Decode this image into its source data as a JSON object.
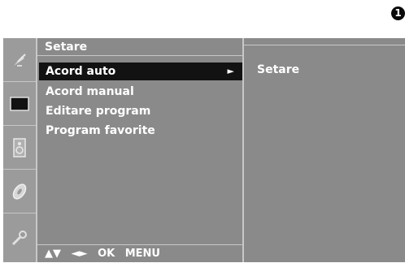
{
  "badge": "1",
  "menu": {
    "title": "Setare",
    "items": [
      {
        "label": "Acord auto",
        "arrow": "►",
        "selected": true
      },
      {
        "label": "Acord manual"
      },
      {
        "label": "Editare program"
      },
      {
        "label": "Program favorite"
      }
    ],
    "footer": [
      "▲▼",
      "◄►",
      "OK",
      "MENU"
    ]
  },
  "submenu": {
    "label": "Setare"
  },
  "icons": [
    "satellite-dish-icon",
    "screen-icon",
    "speaker-icon",
    "disc-icon",
    "wrench-icon"
  ],
  "colors": {
    "panel": "#8a8a8a",
    "selection": "#121212",
    "text": "#ffffff"
  }
}
